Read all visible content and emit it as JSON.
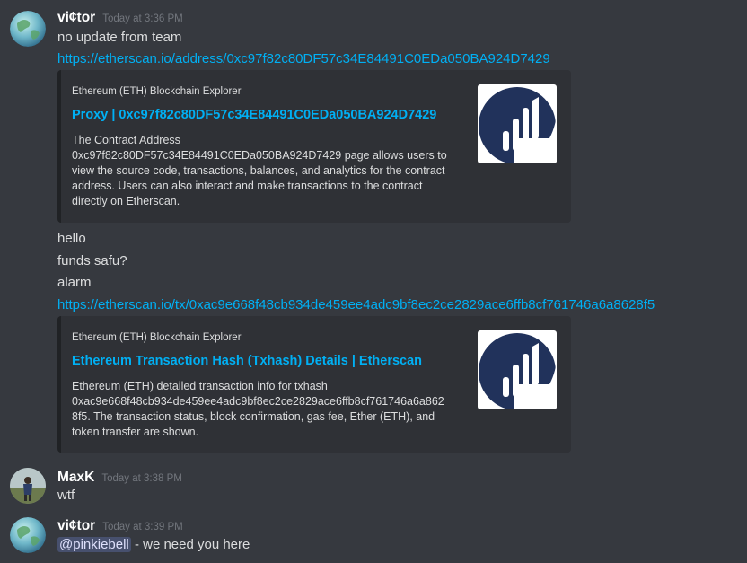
{
  "messages": [
    {
      "username": "vi¢tor",
      "timestamp": "Today at 3:36 PM",
      "avatar_icon": "earth-globe-avatar",
      "lines": [
        "no update from team"
      ],
      "link1": "https://etherscan.io/address/0xc97f82c80DF57c34E84491C0EDa050BA924D7429",
      "embed1": {
        "provider": "Ethereum (ETH) Blockchain Explorer",
        "title": "Proxy | 0xc97f82c80DF57c34E84491C0EDa050BA924D7429",
        "description": [
          "The Contract Address",
          "0xc97f82c80DF57c34E84491C0EDa050BA924D7429 page allows users to",
          "view the source code, transactions, balances, and analytics for the contract",
          "address. Users can also interact and make transactions to the contract",
          "directly on Etherscan."
        ],
        "thumbnail_icon": "etherscan-logo-icon"
      },
      "lines2": [
        "hello",
        "funds safu?",
        "alarm"
      ],
      "link2": "https://etherscan.io/tx/0xac9e668f48cb934de459ee4adc9bf8ec2ce2829ace6ffb8cf761746a6a8628f5",
      "embed2": {
        "provider": "Ethereum (ETH) Blockchain Explorer",
        "title": "Ethereum Transaction Hash (Txhash) Details | Etherscan",
        "description": [
          "Ethereum (ETH) detailed transaction info for txhash",
          "0xac9e668f48cb934de459ee4adc9bf8ec2ce2829ace6ffb8cf761746a6a862",
          "8f5. The transaction status, block confirmation, gas fee, Ether (ETH), and",
          "token transfer are shown."
        ],
        "thumbnail_icon": "etherscan-logo-icon"
      }
    },
    {
      "username": "MaxK",
      "timestamp": "Today at 3:38 PM",
      "avatar_icon": "person-photo-avatar",
      "lines": [
        "wtf"
      ]
    },
    {
      "username": "vi¢tor",
      "timestamp": "Today at 3:39 PM",
      "avatar_icon": "earth-globe-avatar",
      "mention": "@pinkiebell",
      "text_after_mention": " - we need you here"
    }
  ],
  "colors": {
    "background": "#36393f",
    "embed_background": "#2f3136",
    "link": "#00b0f4",
    "username": "#ffffff",
    "timestamp": "#72767d",
    "text": "#dcddde",
    "mention_bg": "#4a5188",
    "etherscan_blue": "#21325b"
  }
}
